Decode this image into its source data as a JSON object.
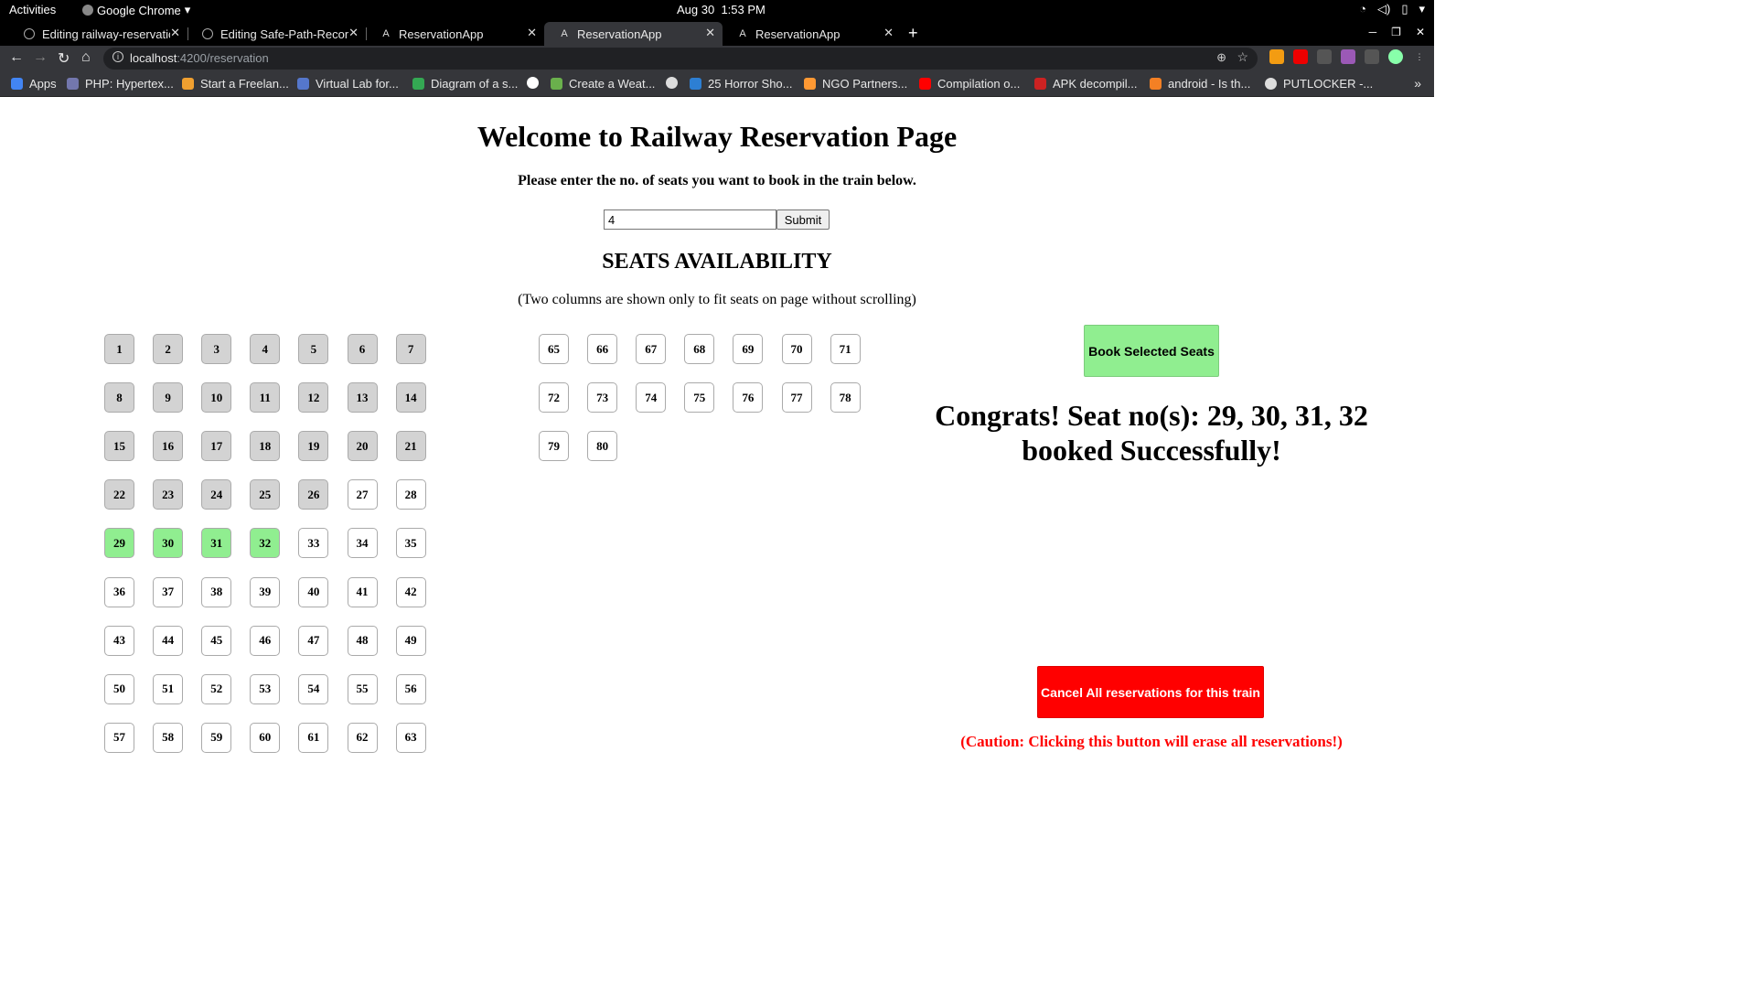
{
  "system_bar": {
    "activities": "Activities",
    "app_name": "Google Chrome",
    "date": "Aug 30",
    "time": "1:53 PM"
  },
  "tabs": [
    {
      "title": "Editing railway-reservatio",
      "icon": "github-icon",
      "active": false
    },
    {
      "title": "Editing Safe-Path-Recomm",
      "icon": "github-icon",
      "active": false
    },
    {
      "title": "ReservationApp",
      "icon": "angular-icon",
      "active": false
    },
    {
      "title": "ReservationApp",
      "icon": "angular-icon",
      "active": true
    },
    {
      "title": "ReservationApp",
      "icon": "angular-icon",
      "active": false
    }
  ],
  "address_bar": {
    "host": "localhost",
    "path": ":4200/reservation"
  },
  "bookmarks": [
    {
      "label": "Apps",
      "color": "#4285f4"
    },
    {
      "label": "PHP: Hypertex...",
      "color": "#7377ad"
    },
    {
      "label": "Start a Freelan...",
      "color": "#f0a030"
    },
    {
      "label": "Virtual Lab for...",
      "color": "#5577cc"
    },
    {
      "label": "Diagram of a s...",
      "color": "#34a853"
    },
    {
      "label": "Create a Weat...",
      "color": "#6ab04c"
    },
    {
      "label": "25 Horror Sho...",
      "color": "#2d7fd3"
    },
    {
      "label": "NGO Partners...",
      "color": "#ff9933"
    },
    {
      "label": "Compilation o...",
      "color": "#ff0000"
    },
    {
      "label": "APK decompil...",
      "color": "#cc2222"
    },
    {
      "label": "android - Is th...",
      "color": "#f48024"
    },
    {
      "label": "PUTLOCKER -...",
      "color": "#dddddd"
    }
  ],
  "page": {
    "title": "Welcome to Railway Reservation Page",
    "prompt": "Please enter the no. of seats you want to book in the train below.",
    "input_value": "4",
    "submit_label": "Submit",
    "availability_heading": "SEATS AVAILABILITY",
    "columns_note": "(Two columns are shown only to fit seats on page without scrolling)",
    "book_button": "Book Selected Seats",
    "congrats_message": "Congrats! Seat no(s): 29, 30, 31, 32 booked Successfully!",
    "cancel_button": "Cancel All reservations for this train",
    "caution": "(Caution: Clicking this button will erase all reservations!)"
  },
  "seats": {
    "total": 80,
    "booked": [
      1,
      2,
      3,
      4,
      5,
      6,
      7,
      8,
      9,
      10,
      11,
      12,
      13,
      14,
      15,
      16,
      17,
      18,
      19,
      20,
      21,
      22,
      23,
      24,
      25,
      26
    ],
    "selected": [
      29,
      30,
      31,
      32
    ],
    "booked_color": "#d3d3d3",
    "selected_color": "#90ee90"
  },
  "colors": {
    "book_button": "#90ee90",
    "cancel_button": "#ff0000",
    "caution_text": "#ff0000"
  }
}
